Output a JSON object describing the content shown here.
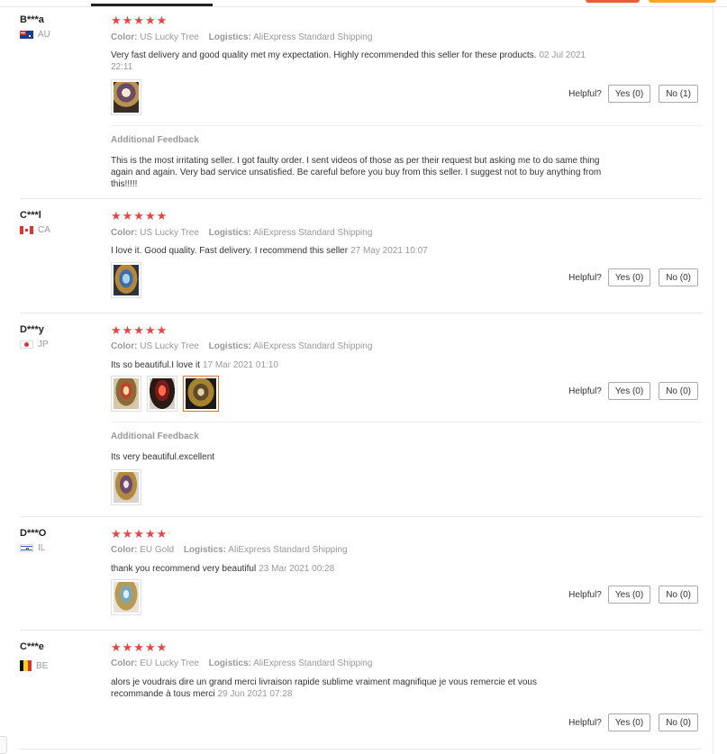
{
  "helpful_label": "Helpful?",
  "additional_feedback_title": "Additional Feedback",
  "labels": {
    "color": "Color:",
    "logistics": "Logistics:"
  },
  "reviews": [
    {
      "user": "B***a",
      "country": "AU",
      "flag": "australia-flag",
      "stars": "★★★★★",
      "color": "US Lucky Tree",
      "logistics": "AliExpress Standard Shipping",
      "text": "Very fast delivery and good quality met my expectation. Highly recommended this seller for these products.",
      "date": "02 Jul 2021 22:11",
      "images": [
        "product-photo"
      ],
      "yes": "Yes (0)",
      "no": "No (1)",
      "additional": {
        "text": "This is the most irritating seller. I got faulty order. I sent videos of those as per their request but asking me to do same thing again and again. Very bad service unsatisfied. Be careful before you buy from this seller. I suggest not to buy anything from this!!!!!"
      }
    },
    {
      "user": "C***l",
      "country": "CA",
      "flag": "canada-flag",
      "stars": "★★★★★",
      "color": "US Lucky Tree",
      "logistics": "AliExpress Standard Shipping",
      "text": "I love it. Good quality. Fast delivery. I recommend this seller",
      "date": "27 May 2021 10:07",
      "images": [
        "product-photo"
      ],
      "yes": "Yes (0)",
      "no": "No (0)"
    },
    {
      "user": "D***y",
      "country": "JP",
      "flag": "japan-flag",
      "stars": "★★★★★",
      "color": "US Lucky Tree",
      "logistics": "AliExpress Standard Shipping",
      "text": "Its so beautiful.I love it",
      "date": "17 Mar 2021 01:10",
      "images": [
        "product-photo",
        "product-photo",
        "product-photo"
      ],
      "yes": "Yes (0)",
      "no": "No (0)",
      "additional": {
        "text": "Its very beautiful.excellent",
        "images": [
          "product-photo"
        ]
      }
    },
    {
      "user": "D***O",
      "country": "IL",
      "flag": "israel-flag",
      "stars": "★★★★★",
      "color": "EU Gold",
      "logistics": "AliExpress Standard Shipping",
      "text": "thank you recommend very beautiful",
      "date": "23 Mar 2021 00:28",
      "images": [
        "product-photo"
      ],
      "yes": "Yes (0)",
      "no": "No (0)"
    },
    {
      "user": "C***e",
      "country": "BE",
      "flag": "belgium-flag",
      "stars": "★★★★★",
      "color": "EU Lucky Tree",
      "logistics": "AliExpress Standard Shipping",
      "text": "alors je voudrais dire un grand merci livraison rapide sublime vraiment magnifique je vous remercie et vous recommande à tous merci",
      "date": "29 Jun 2021 07:28",
      "yes": "Yes (0)",
      "no": "No (0)"
    }
  ],
  "colors": {
    "star": "#e94545",
    "muted": "#999999",
    "selected_border": "#e0742b"
  }
}
